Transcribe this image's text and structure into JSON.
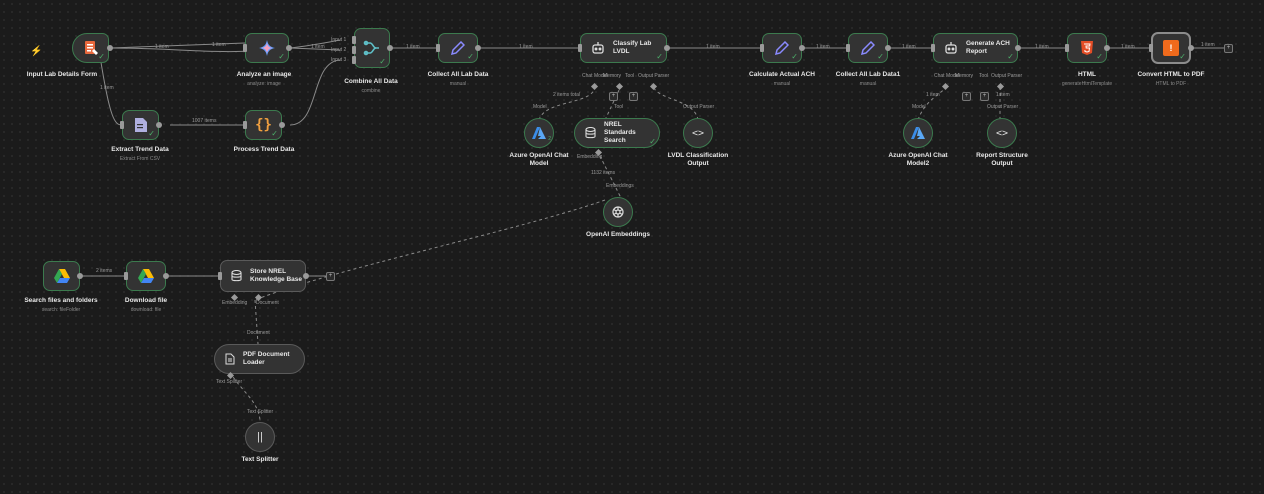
{
  "nodes": {
    "input_form": {
      "title": "Input Lab Details Form"
    },
    "analyze_image": {
      "title": "Analyze an image",
      "subtitle": "analyze: image"
    },
    "combine": {
      "title": "Combine All Data",
      "subtitle": "combine",
      "inputs": [
        "Input 1",
        "Input 2",
        "Input 3"
      ]
    },
    "collect_all": {
      "title": "Collect All Lab Data",
      "subtitle": "manual"
    },
    "classify": {
      "title": "Classify Lab LVDL",
      "ports": [
        "Chat Model",
        "Memory",
        "Tool",
        "Output Parser"
      ]
    },
    "calc_ach": {
      "title": "Calculate Actual ACH",
      "subtitle": "manual"
    },
    "collect_data1": {
      "title": "Collect All Lab Data1",
      "subtitle": "manual"
    },
    "generate_ach": {
      "title": "Generate ACH Report",
      "ports": [
        "Chat Model",
        "Memory",
        "Tool",
        "Output Parser"
      ]
    },
    "html": {
      "title": "HTML",
      "subtitle": "generateHtmlTemplate"
    },
    "convert_pdf": {
      "title": "Convert HTML to PDF",
      "subtitle": "HTML to PDF"
    },
    "extract_trend": {
      "title": "Extract Trend Data",
      "subtitle": "Extract From CSV"
    },
    "process_trend": {
      "title": "Process Trend Data"
    },
    "azure1": {
      "title": "Azure OpenAI Chat Model",
      "badge": "2"
    },
    "nrel_search": {
      "title": "NREL Standards Search",
      "port": "Embedding"
    },
    "lvdl_output": {
      "title": "LVDL Classification Output"
    },
    "azure2": {
      "title": "Azure OpenAI Chat Model2"
    },
    "report_output": {
      "title": "Report Structure Output"
    },
    "openai_emb": {
      "title": "OpenAI Embeddings"
    },
    "search_files": {
      "title": "Search files and folders",
      "subtitle": "search: fileFolder"
    },
    "download_file": {
      "title": "Download file",
      "subtitle": "download: file"
    },
    "store_nrel": {
      "title": "Store NREL Knowledge Base",
      "port": "Embedding",
      "port2": "Document"
    },
    "pdf_loader": {
      "title": "PDF Document Loader",
      "port": "Text Splitter"
    },
    "text_splitter": {
      "title": "Text Splitter"
    }
  },
  "edge_labels": {
    "form_analyze": "1 item",
    "form_combine": "1 item",
    "form_extract": "1 item",
    "extract_process": "1007 items",
    "analyze_combine": "1 item",
    "combine_collect": "1 item",
    "collect_classify": "1 item",
    "classify_calc": "1 item",
    "calc_collect1": "1 item",
    "collect1_generate": "1 item",
    "generate_html": "1 item",
    "html_convert": "1 item",
    "convert_out": "1 item",
    "model1": "Model",
    "model1_items": "2 items total",
    "tool1": "Tool",
    "output_parser1": "Output Parser",
    "embeddings": "Embeddings",
    "emb_items": "1132 items",
    "model2": "Model",
    "model2_items": "1 item",
    "output_parser2": "Output Parser",
    "op2_items": "1 item",
    "search_download": "2 items",
    "document": "Document",
    "text_splitter": "Text Splitter"
  },
  "colors": {
    "bg": "#1b1b1b",
    "node": "#333333",
    "success": "#4caf6a",
    "edge": "#8a8a8a",
    "form_icon": "#e8683c",
    "pdf_icon": "#f06a1c",
    "html_icon": "#e44d26",
    "azure_icon": "#3b8de8",
    "code_icon": "#f0a040",
    "drive_icon": "#34a853"
  }
}
